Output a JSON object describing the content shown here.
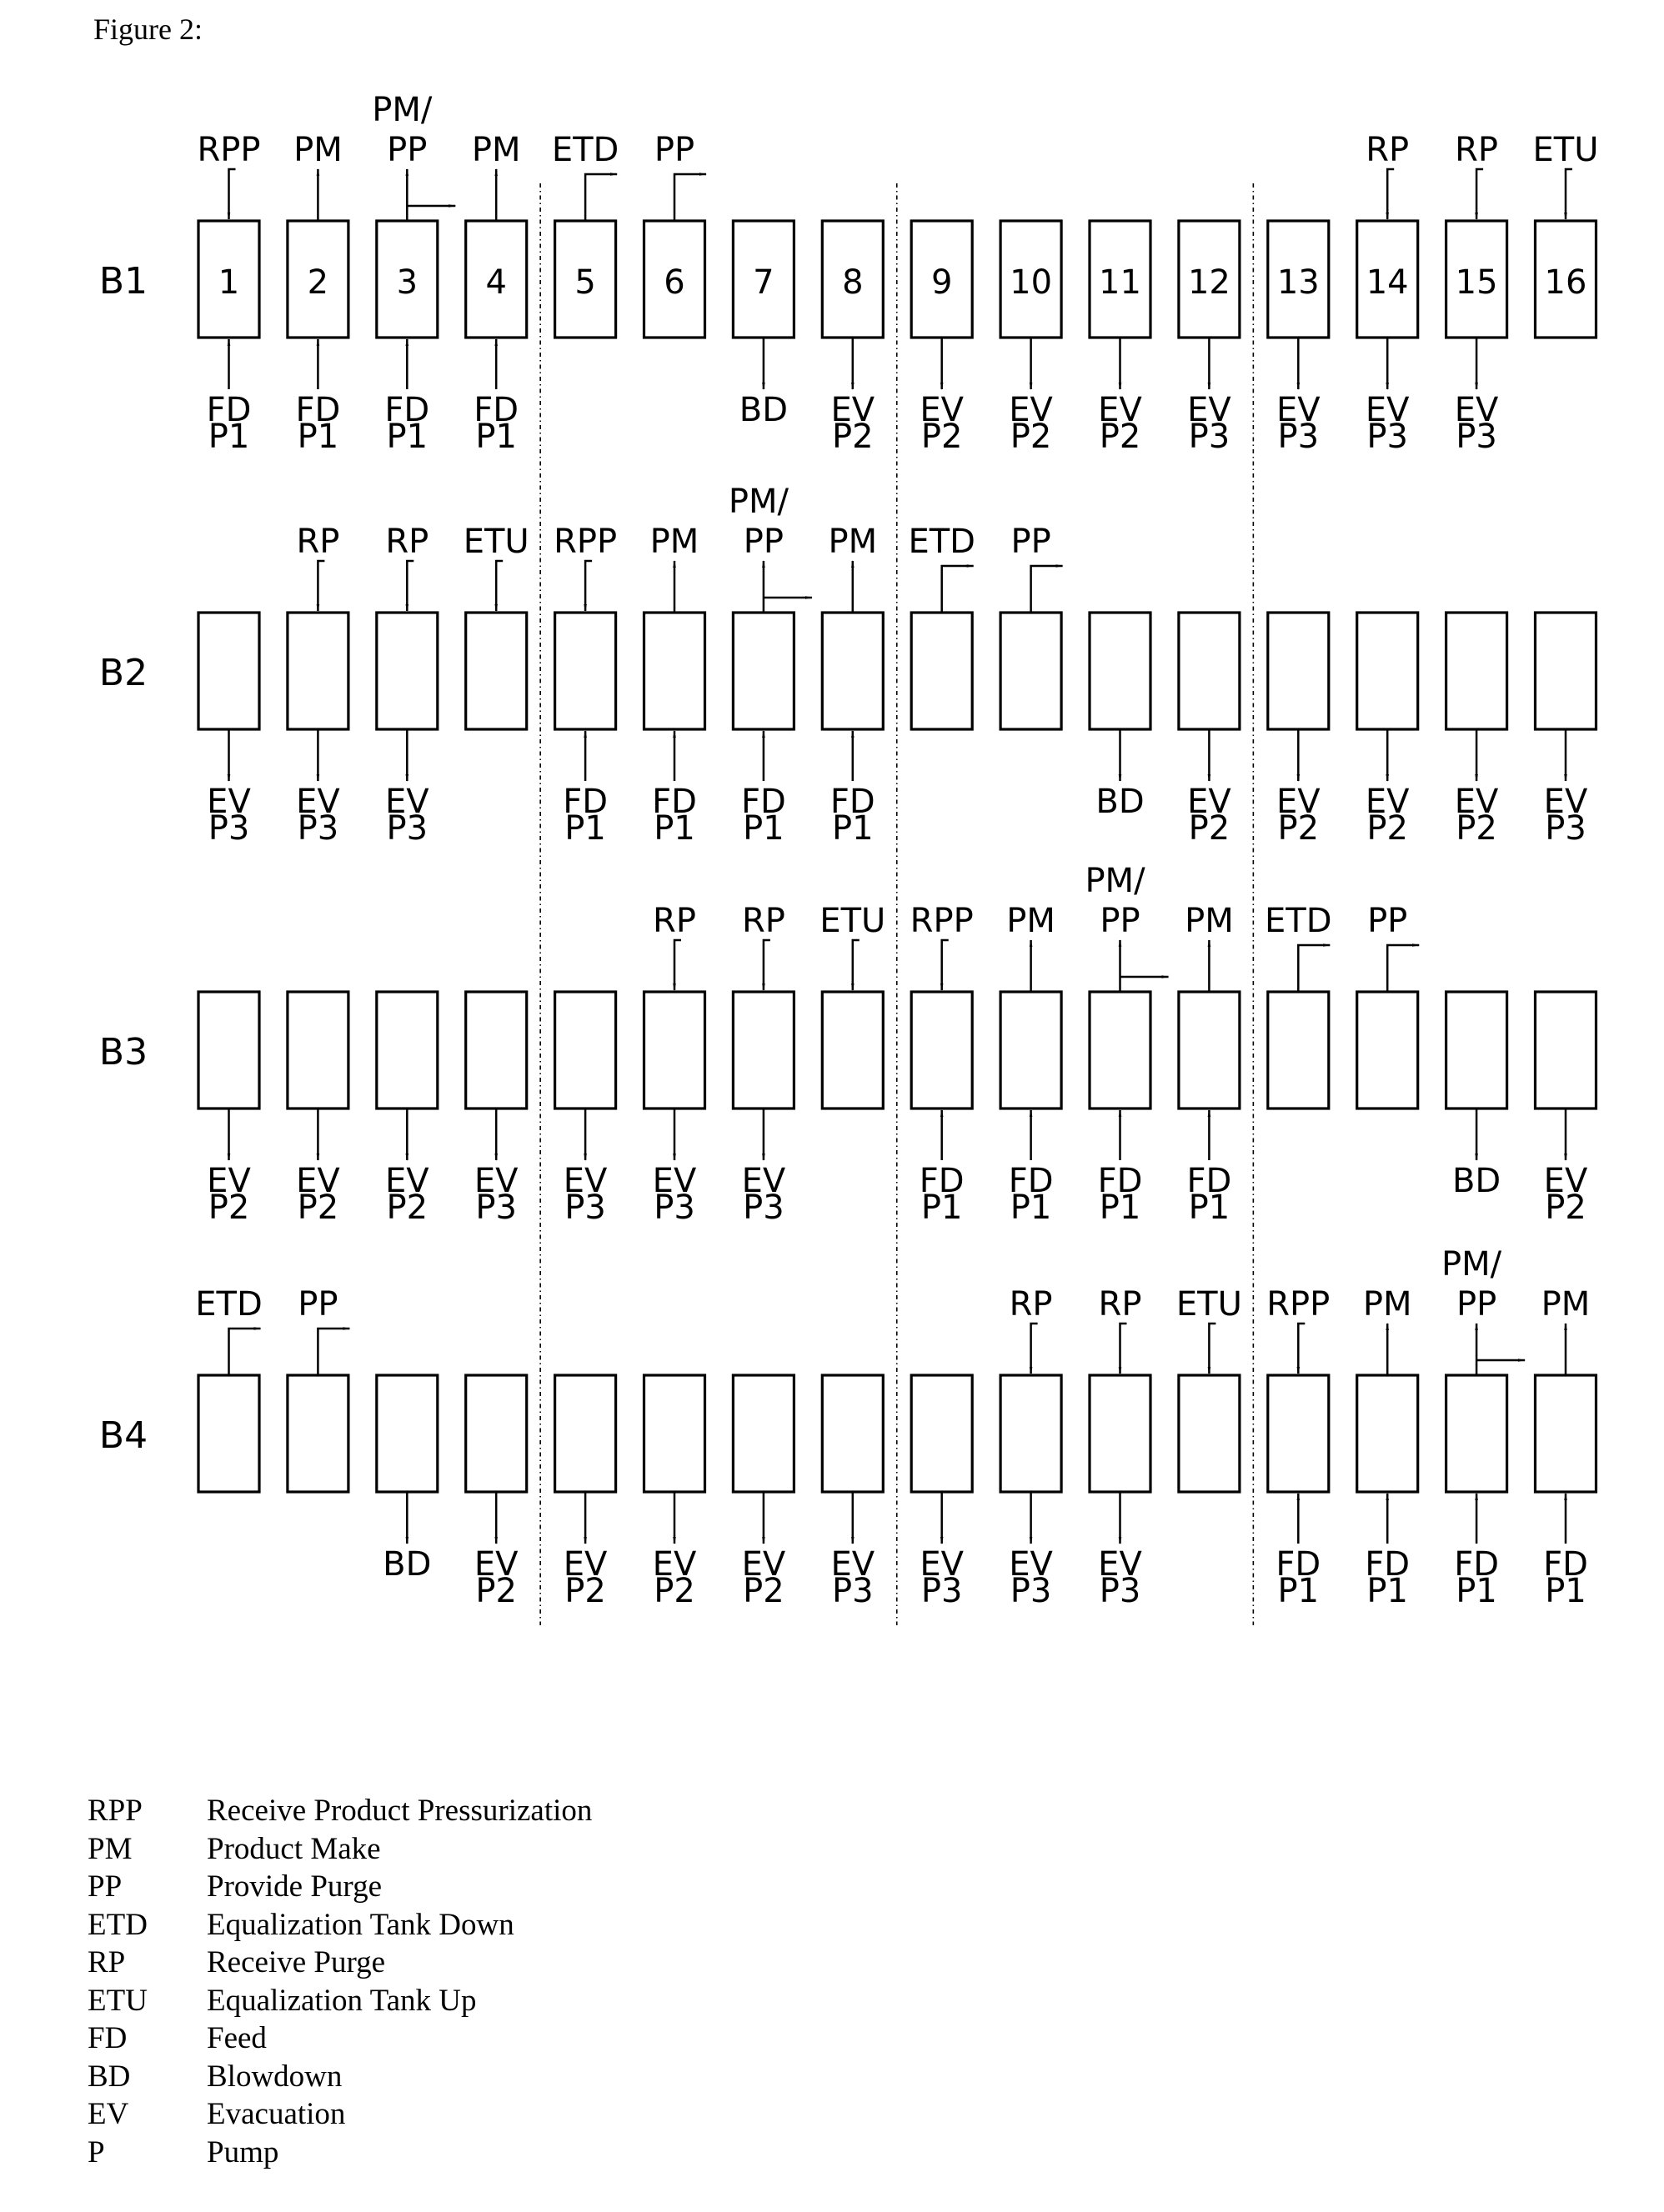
{
  "caption": "Figure 2:",
  "diagram": {
    "type": "cycle-schedule",
    "columns": 16,
    "step_numbers": [
      "1",
      "2",
      "3",
      "4",
      "5",
      "6",
      "7",
      "8",
      "9",
      "10",
      "11",
      "12",
      "13",
      "14",
      "15",
      "16"
    ],
    "beds": [
      {
        "label": "B1",
        "numbered": true,
        "steps": [
          {
            "top": "RPP",
            "top_kind": "in-elbow",
            "bottom": [
              "FD",
              "P1"
            ],
            "bottom_kind": "in"
          },
          {
            "top": "PM",
            "top_kind": "out",
            "bottom": [
              "FD",
              "P1"
            ],
            "bottom_kind": "in"
          },
          {
            "top": "PP",
            "top_pre": "PM/",
            "top_kind": "out-side",
            "bottom": [
              "FD",
              "P1"
            ],
            "bottom_kind": "in"
          },
          {
            "top": "PM",
            "top_kind": "out",
            "bottom": [
              "FD",
              "P1"
            ],
            "bottom_kind": "in"
          },
          {
            "top": "ETD",
            "top_kind": "out-elbow",
            "bottom": null,
            "bottom_kind": null
          },
          {
            "top": "PP",
            "top_kind": "out-elbow",
            "bottom": null,
            "bottom_kind": null
          },
          {
            "top": null,
            "top_kind": null,
            "bottom": [
              "BD"
            ],
            "bottom_kind": "out"
          },
          {
            "top": null,
            "top_kind": null,
            "bottom": [
              "EV",
              "P2"
            ],
            "bottom_kind": "out"
          },
          {
            "top": null,
            "top_kind": null,
            "bottom": [
              "EV",
              "P2"
            ],
            "bottom_kind": "out"
          },
          {
            "top": null,
            "top_kind": null,
            "bottom": [
              "EV",
              "P2"
            ],
            "bottom_kind": "out"
          },
          {
            "top": null,
            "top_kind": null,
            "bottom": [
              "EV",
              "P2"
            ],
            "bottom_kind": "out"
          },
          {
            "top": null,
            "top_kind": null,
            "bottom": [
              "EV",
              "P3"
            ],
            "bottom_kind": "out"
          },
          {
            "top": null,
            "top_kind": null,
            "bottom": [
              "EV",
              "P3"
            ],
            "bottom_kind": "out"
          },
          {
            "top": "RP",
            "top_kind": "in-elbow",
            "bottom": [
              "EV",
              "P3"
            ],
            "bottom_kind": "out"
          },
          {
            "top": "RP",
            "top_kind": "in-elbow",
            "bottom": [
              "EV",
              "P3"
            ],
            "bottom_kind": "out"
          },
          {
            "top": "ETU",
            "top_kind": "in-elbow",
            "bottom": null,
            "bottom_kind": null
          }
        ]
      },
      {
        "label": "B2",
        "numbered": false,
        "steps": [
          {
            "top": null,
            "top_kind": null,
            "bottom": [
              "EV",
              "P3"
            ],
            "bottom_kind": "out"
          },
          {
            "top": "RP",
            "top_kind": "in-elbow",
            "bottom": [
              "EV",
              "P3"
            ],
            "bottom_kind": "out"
          },
          {
            "top": "RP",
            "top_kind": "in-elbow",
            "bottom": [
              "EV",
              "P3"
            ],
            "bottom_kind": "out"
          },
          {
            "top": "ETU",
            "top_kind": "in-elbow",
            "bottom": null,
            "bottom_kind": null
          },
          {
            "top": "RPP",
            "top_kind": "in-elbow",
            "bottom": [
              "FD",
              "P1"
            ],
            "bottom_kind": "in"
          },
          {
            "top": "PM",
            "top_kind": "out",
            "bottom": [
              "FD",
              "P1"
            ],
            "bottom_kind": "in"
          },
          {
            "top": "PP",
            "top_pre": "PM/",
            "top_kind": "out-side",
            "bottom": [
              "FD",
              "P1"
            ],
            "bottom_kind": "in"
          },
          {
            "top": "PM",
            "top_kind": "out",
            "bottom": [
              "FD",
              "P1"
            ],
            "bottom_kind": "in"
          },
          {
            "top": "ETD",
            "top_kind": "out-elbow",
            "bottom": null,
            "bottom_kind": null
          },
          {
            "top": "PP",
            "top_kind": "out-elbow",
            "bottom": null,
            "bottom_kind": null
          },
          {
            "top": null,
            "top_kind": null,
            "bottom": [
              "BD"
            ],
            "bottom_kind": "out"
          },
          {
            "top": null,
            "top_kind": null,
            "bottom": [
              "EV",
              "P2"
            ],
            "bottom_kind": "out"
          },
          {
            "top": null,
            "top_kind": null,
            "bottom": [
              "EV",
              "P2"
            ],
            "bottom_kind": "out"
          },
          {
            "top": null,
            "top_kind": null,
            "bottom": [
              "EV",
              "P2"
            ],
            "bottom_kind": "out"
          },
          {
            "top": null,
            "top_kind": null,
            "bottom": [
              "EV",
              "P2"
            ],
            "bottom_kind": "out"
          },
          {
            "top": null,
            "top_kind": null,
            "bottom": [
              "EV",
              "P3"
            ],
            "bottom_kind": "out"
          }
        ]
      },
      {
        "label": "B3",
        "numbered": false,
        "steps": [
          {
            "top": null,
            "top_kind": null,
            "bottom": [
              "EV",
              "P2"
            ],
            "bottom_kind": "out"
          },
          {
            "top": null,
            "top_kind": null,
            "bottom": [
              "EV",
              "P2"
            ],
            "bottom_kind": "out"
          },
          {
            "top": null,
            "top_kind": null,
            "bottom": [
              "EV",
              "P2"
            ],
            "bottom_kind": "out"
          },
          {
            "top": null,
            "top_kind": null,
            "bottom": [
              "EV",
              "P3"
            ],
            "bottom_kind": "out"
          },
          {
            "top": null,
            "top_kind": null,
            "bottom": [
              "EV",
              "P3"
            ],
            "bottom_kind": "out"
          },
          {
            "top": "RP",
            "top_kind": "in-elbow",
            "bottom": [
              "EV",
              "P3"
            ],
            "bottom_kind": "out"
          },
          {
            "top": "RP",
            "top_kind": "in-elbow",
            "bottom": [
              "EV",
              "P3"
            ],
            "bottom_kind": "out"
          },
          {
            "top": "ETU",
            "top_kind": "in-elbow",
            "bottom": null,
            "bottom_kind": null
          },
          {
            "top": "RPP",
            "top_kind": "in-elbow",
            "bottom": [
              "FD",
              "P1"
            ],
            "bottom_kind": "in"
          },
          {
            "top": "PM",
            "top_kind": "out",
            "bottom": [
              "FD",
              "P1"
            ],
            "bottom_kind": "in"
          },
          {
            "top": "PP",
            "top_pre": "PM/",
            "top_kind": "out-side",
            "bottom": [
              "FD",
              "P1"
            ],
            "bottom_kind": "in"
          },
          {
            "top": "PM",
            "top_kind": "out",
            "bottom": [
              "FD",
              "P1"
            ],
            "bottom_kind": "in"
          },
          {
            "top": "ETD",
            "top_kind": "out-elbow",
            "bottom": null,
            "bottom_kind": null
          },
          {
            "top": "PP",
            "top_kind": "out-elbow",
            "bottom": null,
            "bottom_kind": null
          },
          {
            "top": null,
            "top_kind": null,
            "bottom": [
              "BD"
            ],
            "bottom_kind": "out"
          },
          {
            "top": null,
            "top_kind": null,
            "bottom": [
              "EV",
              "P2"
            ],
            "bottom_kind": "out"
          }
        ]
      },
      {
        "label": "B4",
        "numbered": false,
        "steps": [
          {
            "top": "ETD",
            "top_kind": "out-elbow",
            "bottom": null,
            "bottom_kind": null
          },
          {
            "top": "PP",
            "top_kind": "out-elbow",
            "bottom": null,
            "bottom_kind": null
          },
          {
            "top": null,
            "top_kind": null,
            "bottom": [
              "BD"
            ],
            "bottom_kind": "out"
          },
          {
            "top": null,
            "top_kind": null,
            "bottom": [
              "EV",
              "P2"
            ],
            "bottom_kind": "out"
          },
          {
            "top": null,
            "top_kind": null,
            "bottom": [
              "EV",
              "P2"
            ],
            "bottom_kind": "out"
          },
          {
            "top": null,
            "top_kind": null,
            "bottom": [
              "EV",
              "P2"
            ],
            "bottom_kind": "out"
          },
          {
            "top": null,
            "top_kind": null,
            "bottom": [
              "EV",
              "P2"
            ],
            "bottom_kind": "out"
          },
          {
            "top": null,
            "top_kind": null,
            "bottom": [
              "EV",
              "P3"
            ],
            "bottom_kind": "out"
          },
          {
            "top": null,
            "top_kind": null,
            "bottom": [
              "EV",
              "P3"
            ],
            "bottom_kind": "out"
          },
          {
            "top": "RP",
            "top_kind": "in-elbow",
            "bottom": [
              "EV",
              "P3"
            ],
            "bottom_kind": "out"
          },
          {
            "top": "RP",
            "top_kind": "in-elbow",
            "bottom": [
              "EV",
              "P3"
            ],
            "bottom_kind": "out"
          },
          {
            "top": "ETU",
            "top_kind": "in-elbow",
            "bottom": null,
            "bottom_kind": null
          },
          {
            "top": "RPP",
            "top_kind": "in-elbow",
            "bottom": [
              "FD",
              "P1"
            ],
            "bottom_kind": "in"
          },
          {
            "top": "PM",
            "top_kind": "out",
            "bottom": [
              "FD",
              "P1"
            ],
            "bottom_kind": "in"
          },
          {
            "top": "PP",
            "top_pre": "PM/",
            "top_kind": "out-side",
            "bottom": [
              "FD",
              "P1"
            ],
            "bottom_kind": "in"
          },
          {
            "top": "PM",
            "top_kind": "out",
            "bottom": [
              "FD",
              "P1"
            ],
            "bottom_kind": "in"
          }
        ]
      }
    ],
    "dividers_after_step": [
      4,
      8,
      12
    ]
  },
  "legend": [
    {
      "abbr": "RPP",
      "meaning": "Receive Product Pressurization"
    },
    {
      "abbr": "PM",
      "meaning": "Product Make"
    },
    {
      "abbr": "PP",
      "meaning": "Provide Purge"
    },
    {
      "abbr": "ETD",
      "meaning": "Equalization Tank Down"
    },
    {
      "abbr": "RP",
      "meaning": "Receive Purge"
    },
    {
      "abbr": "ETU",
      "meaning": "Equalization Tank Up"
    },
    {
      "abbr": "FD",
      "meaning": "Feed"
    },
    {
      "abbr": "BD",
      "meaning": "Blowdown"
    },
    {
      "abbr": "EV",
      "meaning": "Evacuation"
    },
    {
      "abbr": "P",
      "meaning": "Pump"
    }
  ]
}
